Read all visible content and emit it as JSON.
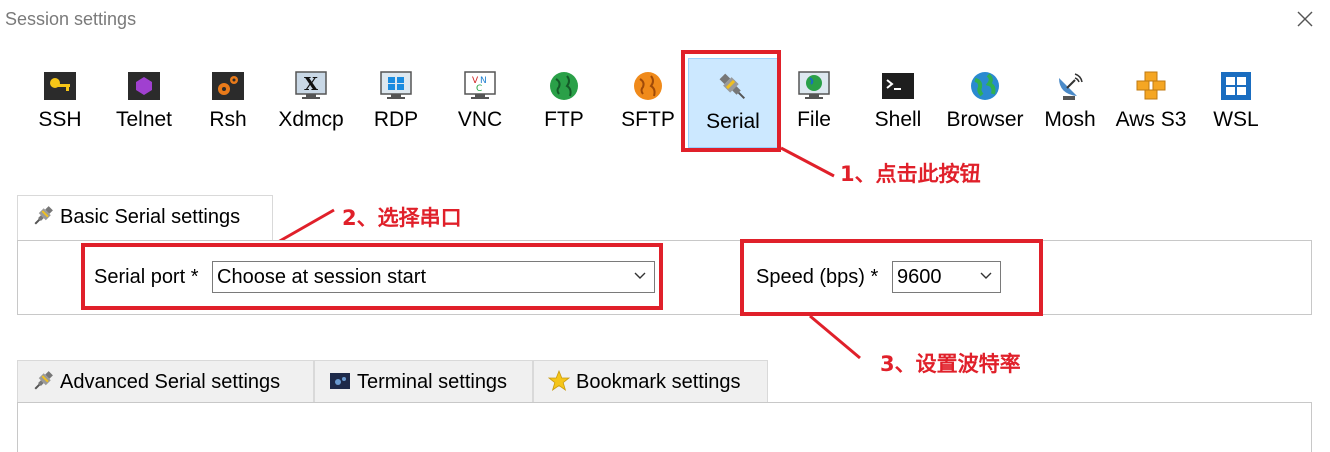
{
  "window": {
    "title": "Session settings"
  },
  "toolbar": {
    "items": [
      {
        "label": "SSH",
        "icon": "key-icon"
      },
      {
        "label": "Telnet",
        "icon": "telnet-icon"
      },
      {
        "label": "Rsh",
        "icon": "gears-icon"
      },
      {
        "label": "Xdmcp",
        "icon": "x-monitor-icon"
      },
      {
        "label": "RDP",
        "icon": "windows-monitor-icon"
      },
      {
        "label": "VNC",
        "icon": "vnc-monitor-icon"
      },
      {
        "label": "FTP",
        "icon": "green-globe-icon"
      },
      {
        "label": "SFTP",
        "icon": "orange-globe-icon"
      },
      {
        "label": "Serial",
        "icon": "serial-plug-icon",
        "selected": true
      },
      {
        "label": "File",
        "icon": "file-globe-monitor-icon"
      },
      {
        "label": "Shell",
        "icon": "terminal-icon"
      },
      {
        "label": "Browser",
        "icon": "globe-icon"
      },
      {
        "label": "Mosh",
        "icon": "satellite-dish-icon"
      },
      {
        "label": "Aws S3",
        "icon": "aws-cubes-icon"
      },
      {
        "label": "WSL",
        "icon": "windows-icon"
      }
    ]
  },
  "basic_tab": {
    "label": "Basic Serial settings"
  },
  "serial_port": {
    "label": "Serial port *",
    "value": "Choose at session start"
  },
  "speed": {
    "label": "Speed (bps) *",
    "value": "9600"
  },
  "lower_tabs": [
    {
      "label": "Advanced Serial settings"
    },
    {
      "label": "Terminal settings"
    },
    {
      "label": "Bookmark settings"
    }
  ],
  "annotations": {
    "step1": "1、点击此按钮",
    "step2": "2、选择串口",
    "step3": "3、设置波特率"
  },
  "colors": {
    "annotation_red": "#e0202a",
    "selected_bg": "#cce8ff"
  }
}
